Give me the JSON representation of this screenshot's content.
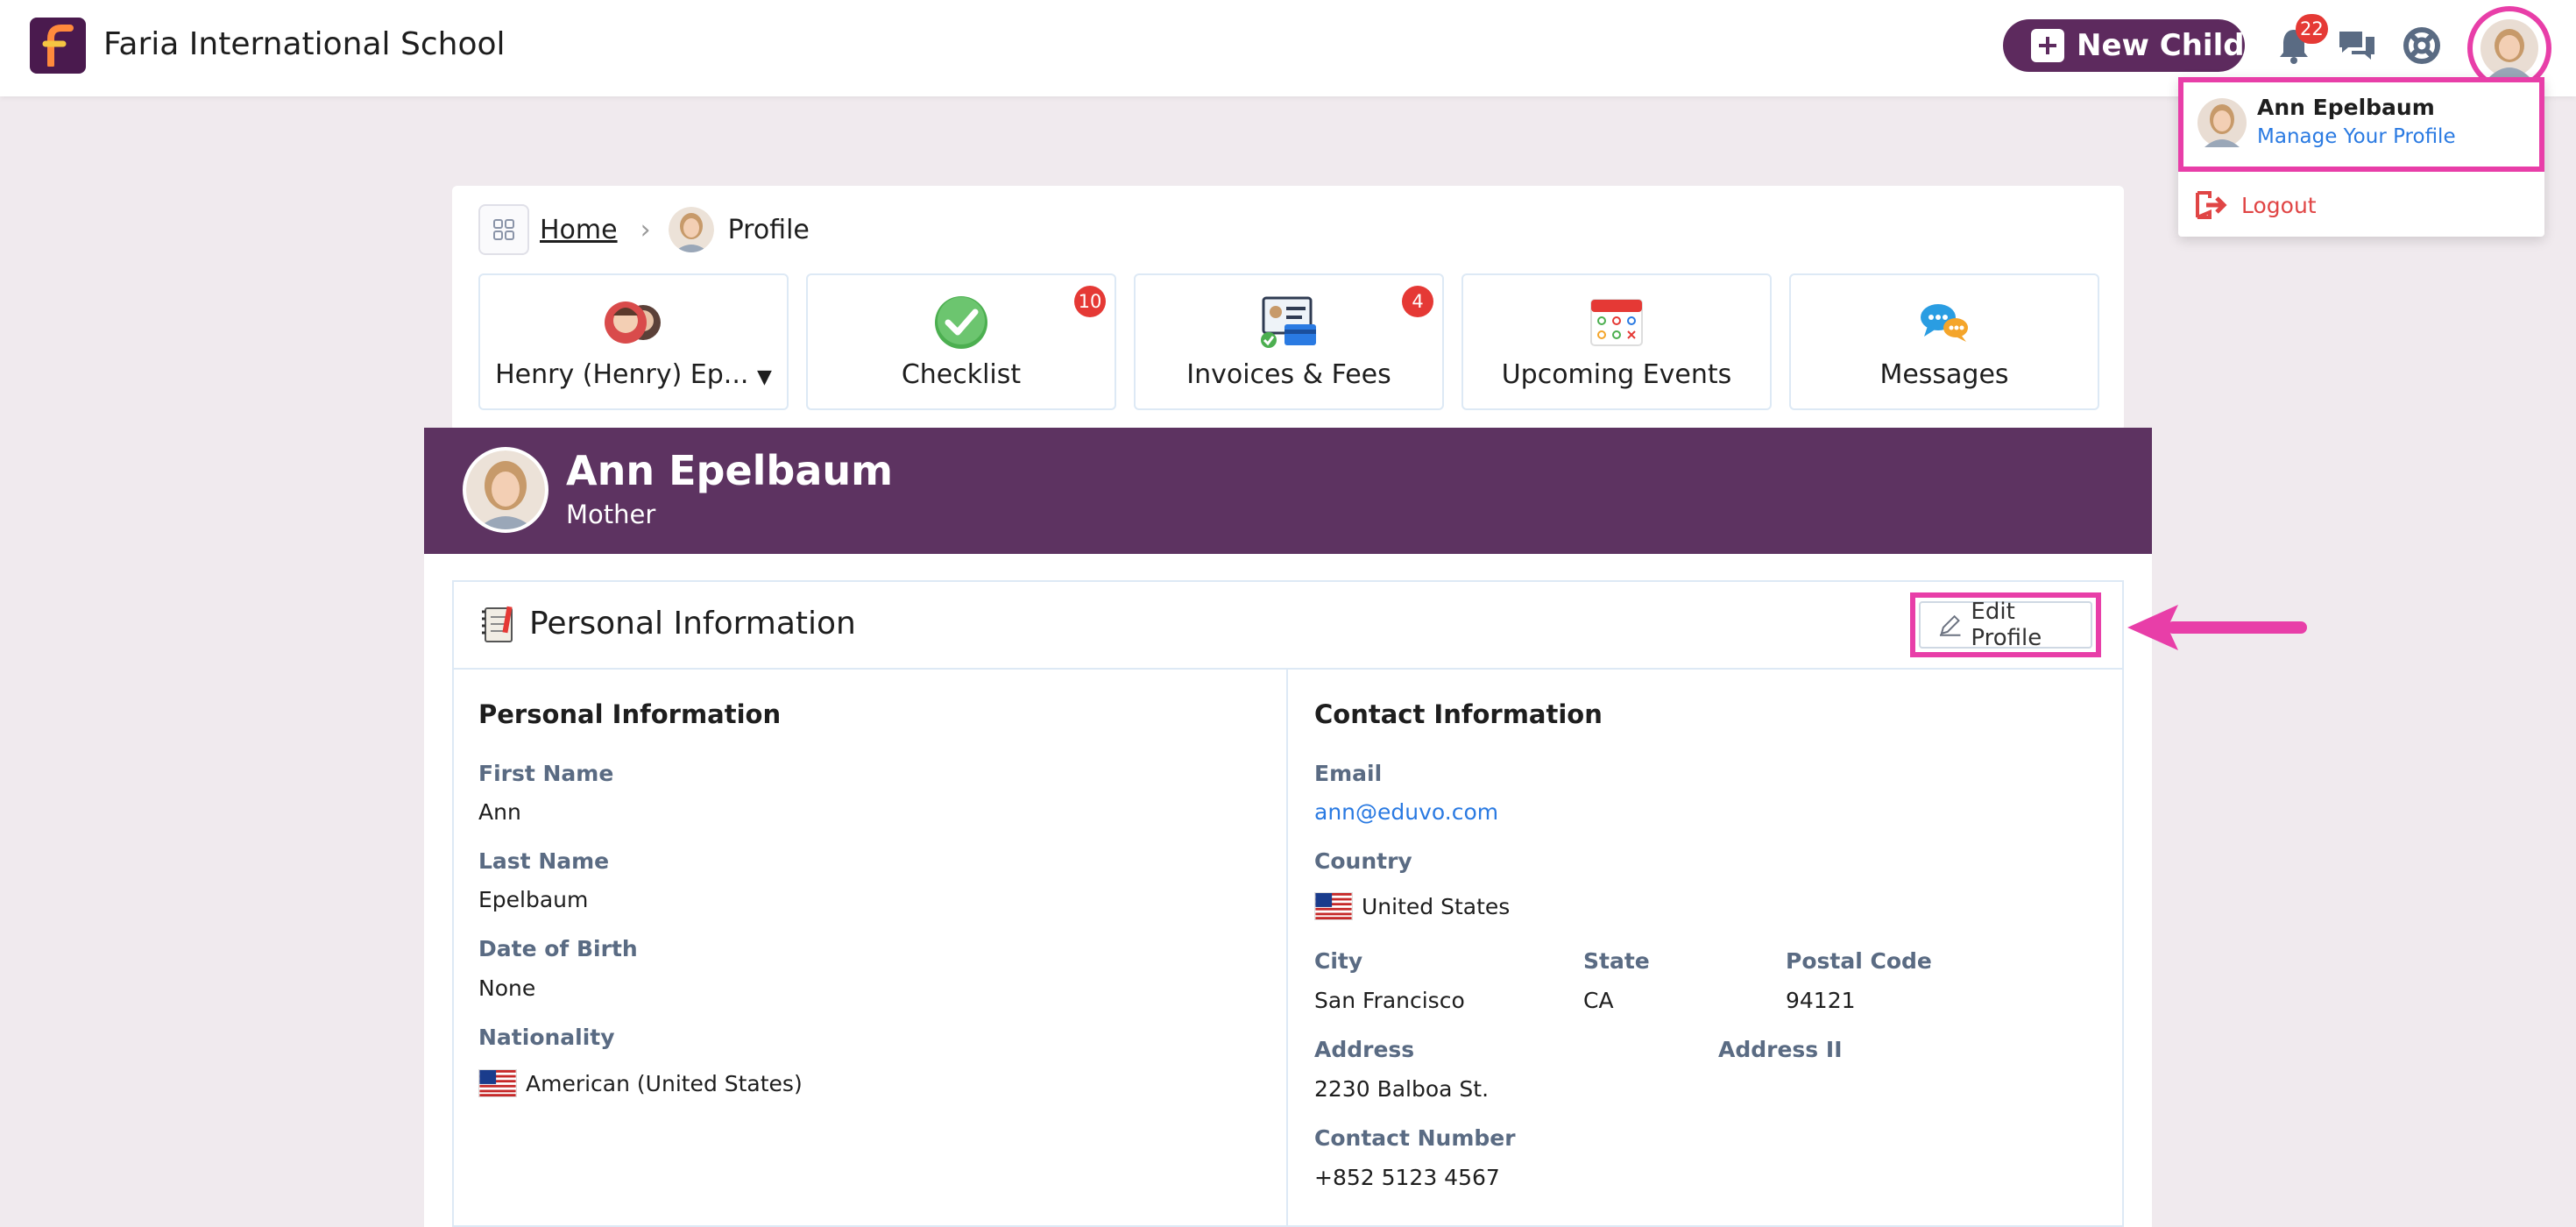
{
  "topbar": {
    "school_name": "Faria International School",
    "new_child_label": "New Child",
    "notifications_count": "22"
  },
  "dropdown": {
    "user_name": "Ann Epelbaum",
    "manage_profile": "Manage Your Profile",
    "logout": "Logout"
  },
  "breadcrumb": {
    "home": "Home",
    "current": "Profile"
  },
  "tiles": [
    {
      "label": "Henry (Henry) Ep...",
      "badge": ""
    },
    {
      "label": "Checklist",
      "badge": "10"
    },
    {
      "label": "Invoices & Fees",
      "badge": "4"
    },
    {
      "label": "Upcoming Events",
      "badge": ""
    },
    {
      "label": "Messages",
      "badge": ""
    }
  ],
  "profile": {
    "name": "Ann Epelbaum",
    "role": "Mother"
  },
  "info_card": {
    "title": "Personal Information",
    "edit_label": "Edit Profile"
  },
  "personal": {
    "heading": "Personal Information",
    "first_name_label": "First Name",
    "first_name": "Ann",
    "last_name_label": "Last Name",
    "last_name": "Epelbaum",
    "dob_label": "Date of Birth",
    "dob": "None",
    "nationality_label": "Nationality",
    "nationality": "American (United States)"
  },
  "contact": {
    "heading": "Contact Information",
    "email_label": "Email",
    "email": "ann@eduvo.com",
    "country_label": "Country",
    "country": "United States",
    "city_label": "City",
    "city": "San Francisco",
    "state_label": "State",
    "state": "CA",
    "postal_label": "Postal Code",
    "postal": "94121",
    "address_label": "Address",
    "address": "2230 Balboa St.",
    "address2_label": "Address II",
    "phone_label": "Contact Number",
    "phone": "+852 5123 4567"
  },
  "colors": {
    "brand_purple": "#5d3361",
    "highlight_pink": "#e83ea8",
    "link_blue": "#2a7ae2",
    "badge_red": "#e53935"
  }
}
